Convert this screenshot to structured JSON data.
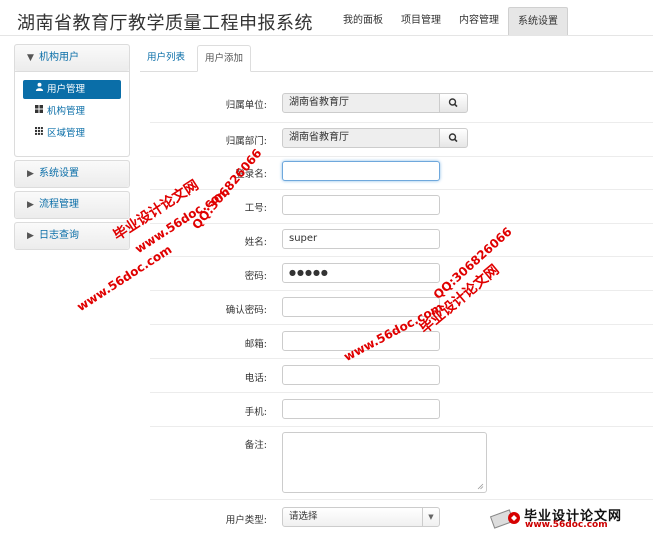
{
  "header": {
    "app_title": "湖南省教育厅教学质量工程申报系统",
    "nav": [
      "我的面板",
      "项目管理",
      "内容管理",
      "系统设置"
    ],
    "active_nav": "系统设置"
  },
  "sidebar": {
    "sections": [
      {
        "label": "机构用户",
        "expanded": true,
        "items": [
          {
            "label": "用户管理",
            "icon": "user-icon",
            "active": true
          },
          {
            "label": "机构管理",
            "icon": "grid-icon",
            "active": false
          },
          {
            "label": "区域管理",
            "icon": "grid-small-icon",
            "active": false
          }
        ]
      },
      {
        "label": "系统设置",
        "expanded": false
      },
      {
        "label": "流程管理",
        "expanded": false
      },
      {
        "label": "日志查询",
        "expanded": false
      }
    ]
  },
  "tabs": [
    {
      "label": "用户列表",
      "active": false
    },
    {
      "label": "用户添加",
      "active": true
    }
  ],
  "form": {
    "unit_label": "归属单位:",
    "unit_value": "湖南省教育厅",
    "dept_label": "归属部门:",
    "dept_value": "湖南省教育厅",
    "login_label": "登录名:",
    "login_value": "",
    "jobno_label": "工号:",
    "jobno_value": "",
    "name_label": "姓名:",
    "name_value": "super",
    "password_label": "密码:",
    "password_value": "●●●●●",
    "confirm_label": "确认密码:",
    "email_label": "邮箱:",
    "phone_label": "电话:",
    "mobile_label": "手机:",
    "remark_label": "备注:",
    "usertype_label": "用户类型:",
    "usertype_value": "请选择"
  },
  "watermarks": {
    "site": "毕业设计论文网",
    "url": "www.56doc.com",
    "qq": "QQ:306826066",
    "color": "#e00000"
  },
  "logo": {
    "name": "毕业设计论文网",
    "url": "www.56doc.com"
  }
}
